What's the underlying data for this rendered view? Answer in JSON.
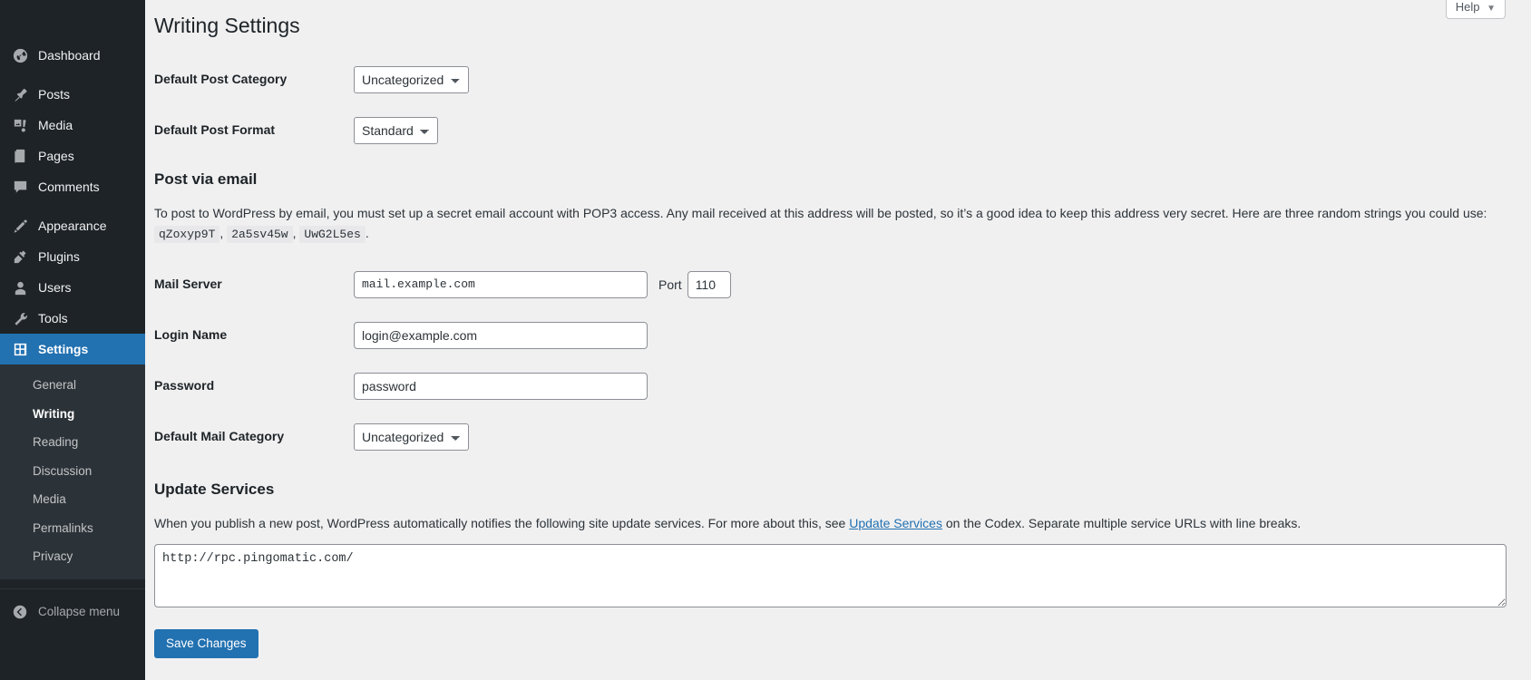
{
  "colors": {
    "sidebar_bg": "#1d2327",
    "submenu_bg": "#2c3338",
    "accent": "#2271b1",
    "content_bg": "#f0f0f1",
    "link": "#2271b1"
  },
  "sidebar": {
    "items": [
      {
        "label": "Dashboard",
        "icon": "dashboard-icon",
        "current": false
      },
      {
        "label": "Posts",
        "icon": "pin-icon",
        "current": false
      },
      {
        "label": "Media",
        "icon": "media-icon",
        "current": false
      },
      {
        "label": "Pages",
        "icon": "pages-icon",
        "current": false
      },
      {
        "label": "Comments",
        "icon": "comments-icon",
        "current": false
      },
      {
        "label": "Appearance",
        "icon": "appearance-brush-icon",
        "current": false
      },
      {
        "label": "Plugins",
        "icon": "plugins-plug-icon",
        "current": false
      },
      {
        "label": "Users",
        "icon": "users-icon",
        "current": false
      },
      {
        "label": "Tools",
        "icon": "tools-wrench-icon",
        "current": false
      },
      {
        "label": "Settings",
        "icon": "settings-sliders-icon",
        "current": true
      }
    ],
    "submenu": [
      {
        "label": "General",
        "current": false
      },
      {
        "label": "Writing",
        "current": true
      },
      {
        "label": "Reading",
        "current": false
      },
      {
        "label": "Discussion",
        "current": false
      },
      {
        "label": "Media",
        "current": false
      },
      {
        "label": "Permalinks",
        "current": false
      },
      {
        "label": "Privacy",
        "current": false
      }
    ],
    "collapse": {
      "label": "Collapse menu",
      "icon": "collapse-arrow-icon"
    }
  },
  "help_tab": {
    "label": "Help",
    "caret": "▼"
  },
  "page": {
    "title": "Writing Settings"
  },
  "fields": {
    "default_post_category": {
      "label": "Default Post Category",
      "value": "Uncategorized",
      "options": [
        "Uncategorized"
      ]
    },
    "default_post_format": {
      "label": "Default Post Format",
      "value": "Standard",
      "options": [
        "Standard"
      ]
    },
    "mail_server": {
      "label": "Mail Server",
      "value": "mail.example.com",
      "port_label": "Port",
      "port_value": "110"
    },
    "login_name": {
      "label": "Login Name",
      "value": "login@example.com"
    },
    "password": {
      "label": "Password",
      "value": "password"
    },
    "default_mail_category": {
      "label": "Default Mail Category",
      "value": "Uncategorized",
      "options": [
        "Uncategorized"
      ]
    }
  },
  "post_via_email": {
    "heading": "Post via email",
    "desc_part1": "To post to WordPress by email, you must set up a secret email account with POP3 access. Any mail received at this address will be posted, so it’s a good idea to keep this address very secret. Here are three random strings you could use:",
    "code1": "qZoxyp9T",
    "sep1": ",",
    "code2": "2a5sv45w",
    "sep2": ",",
    "code3": "UwG2L5es",
    "sep3": "."
  },
  "update_services": {
    "heading": "Update Services",
    "desc_before_link": "When you publish a new post, WordPress automatically notifies the following site update services. For more about this, see ",
    "link_label": "Update Services",
    "desc_after_link": " on the Codex. Separate multiple service URLs with line breaks.",
    "textarea_value": "http://rpc.pingomatic.com/"
  },
  "submit": {
    "label": "Save Changes"
  }
}
